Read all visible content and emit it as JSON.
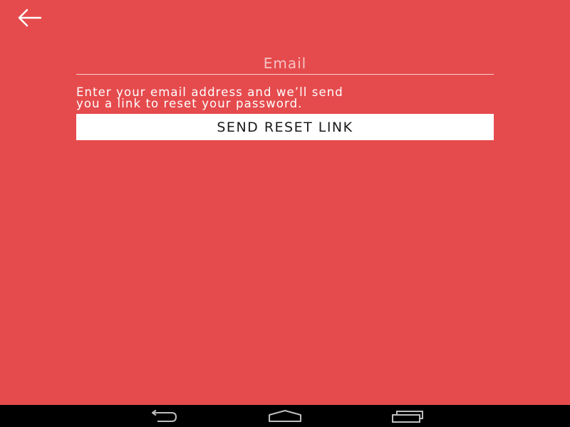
{
  "header": {
    "back_icon": "arrow-left-icon"
  },
  "form": {
    "email_placeholder": "Email",
    "email_value": "",
    "helper_text": "Enter your email address and we’ll send\nyou a link to reset your password.",
    "send_button_label": "SEND RESET LINK"
  },
  "nav_bar": {
    "back_icon": "nav-back-icon",
    "home_icon": "nav-home-icon",
    "recents_icon": "nav-recents-icon"
  },
  "colors": {
    "background": "#E54B4D",
    "button_bg": "#FFFFFF",
    "nav_bar": "#000000"
  }
}
